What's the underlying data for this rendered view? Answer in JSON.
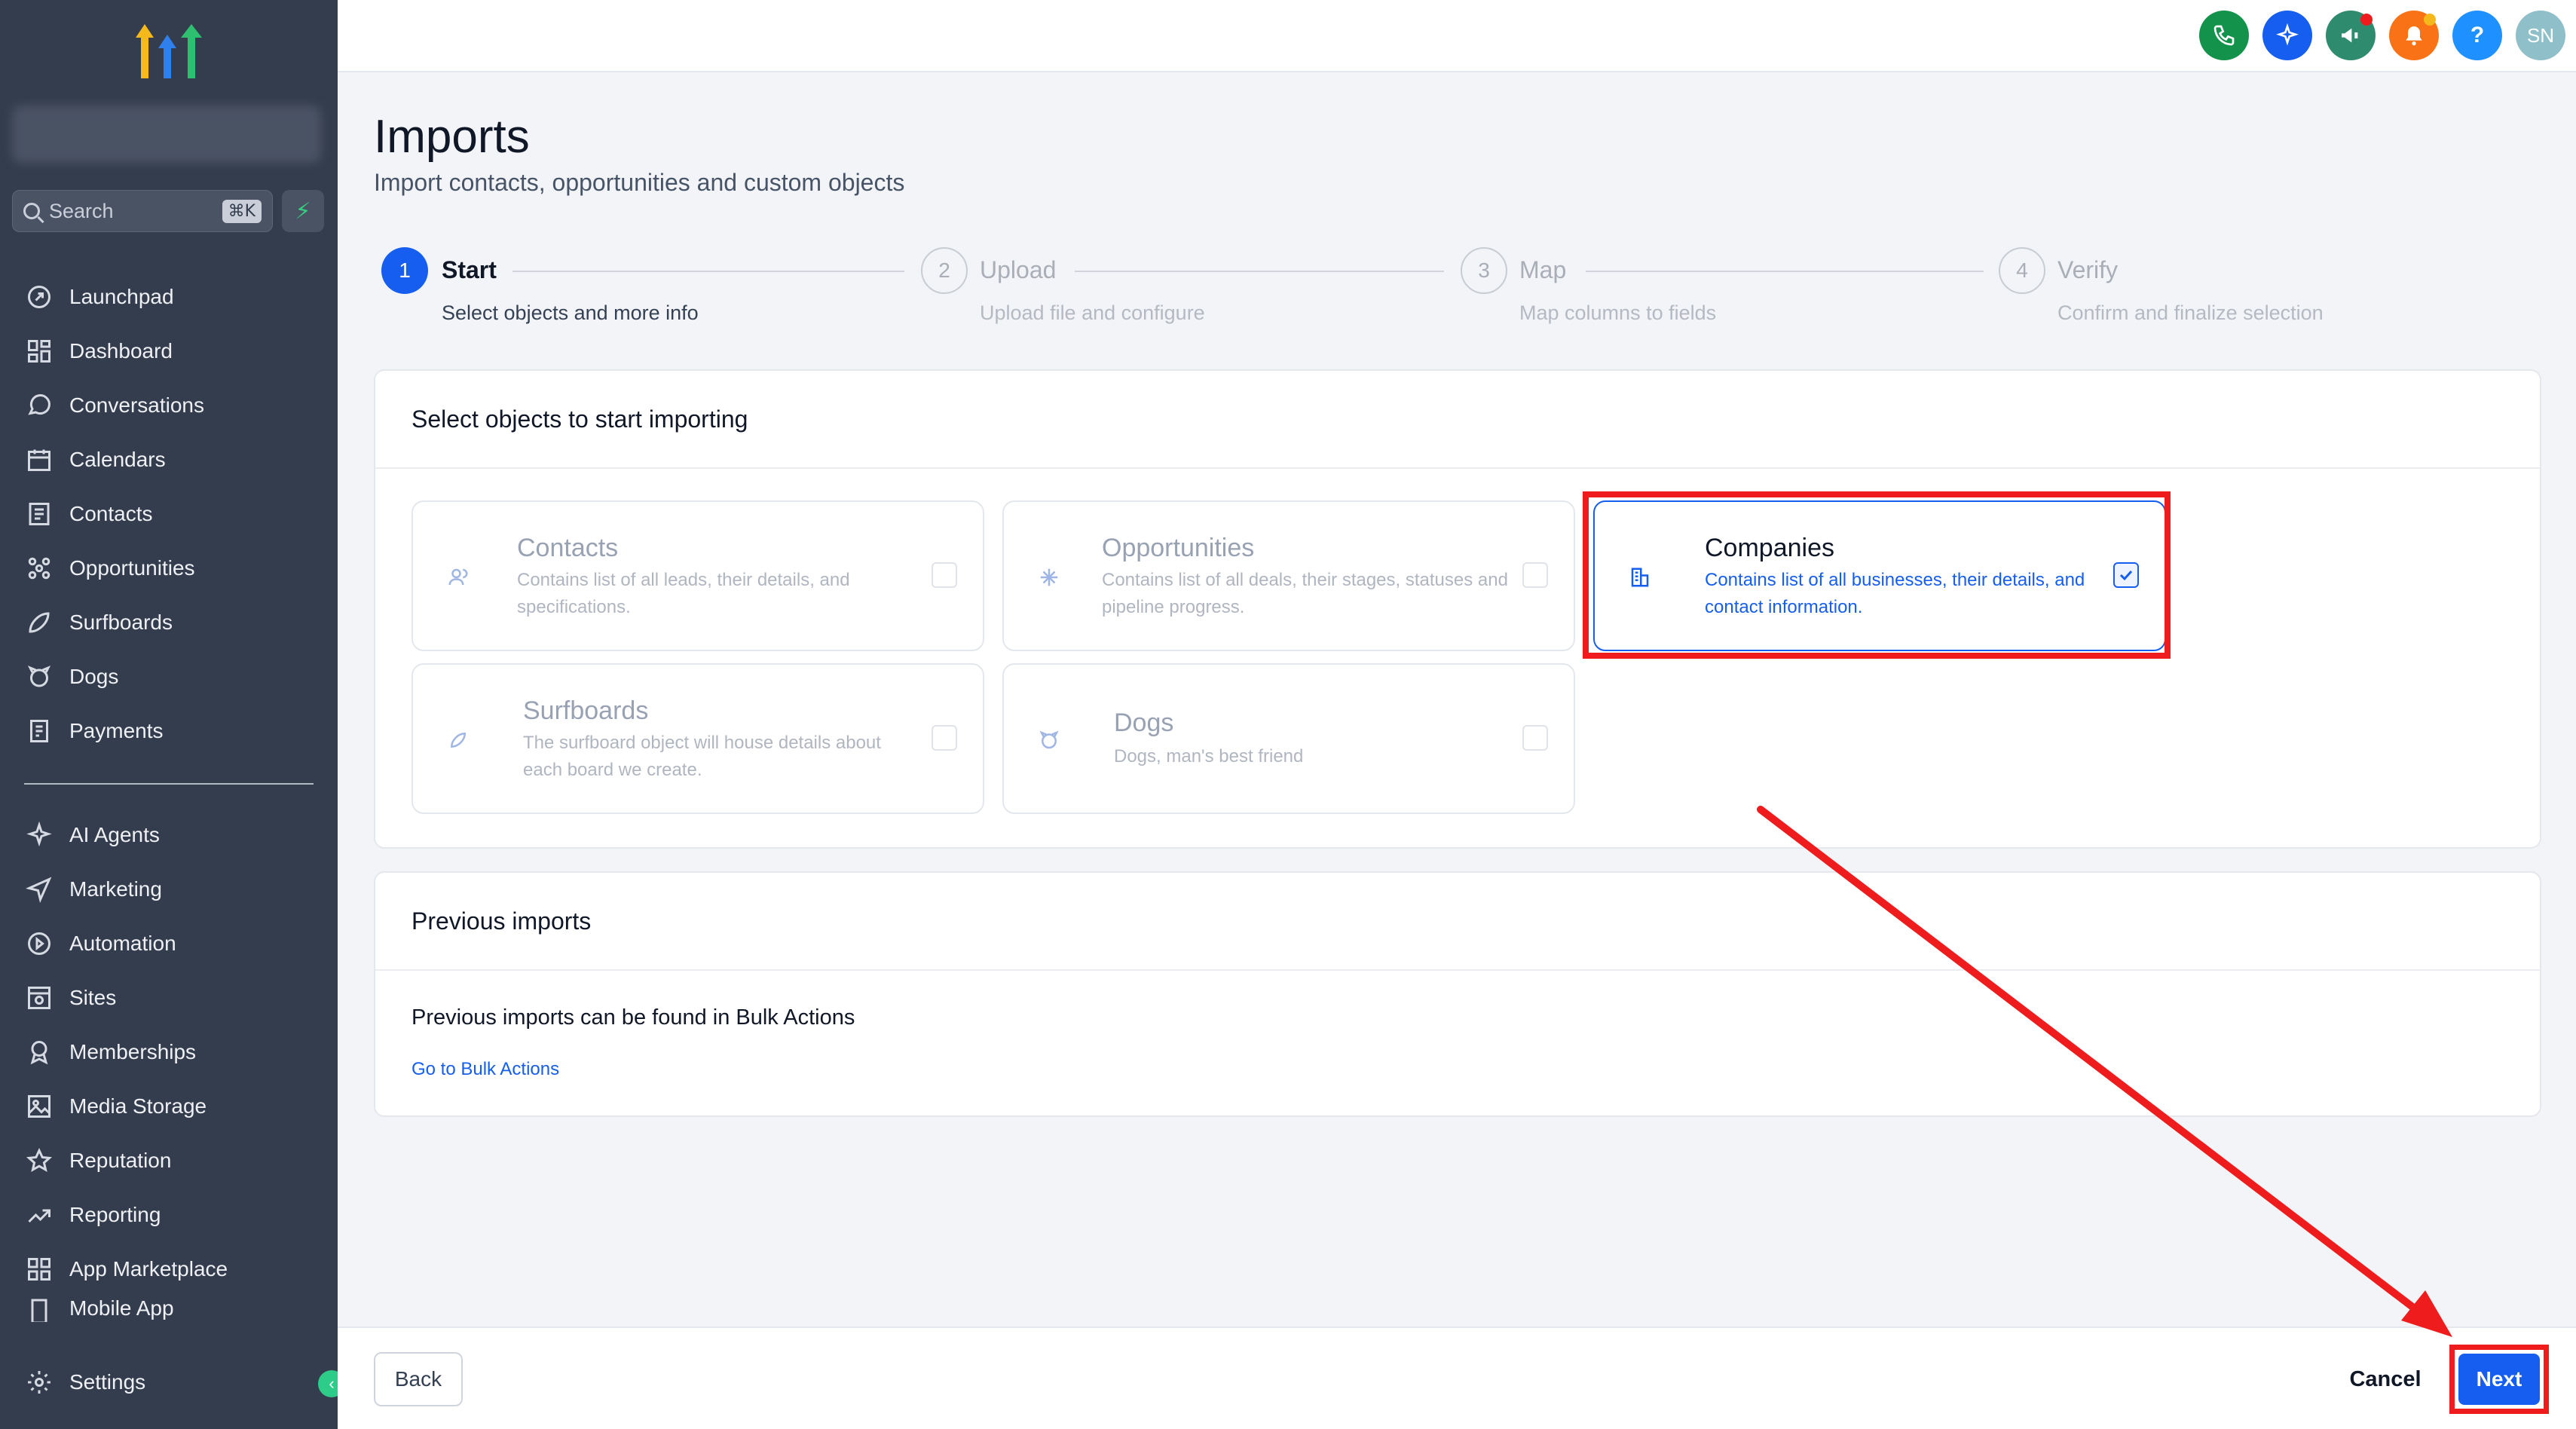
{
  "sidebar": {
    "search_placeholder": "Search",
    "search_shortcut": "⌘K",
    "items_top": [
      {
        "label": "Launchpad",
        "icon": "launchpad-icon"
      },
      {
        "label": "Dashboard",
        "icon": "dashboard-icon"
      },
      {
        "label": "Conversations",
        "icon": "chat-icon"
      },
      {
        "label": "Calendars",
        "icon": "calendar-icon"
      },
      {
        "label": "Contacts",
        "icon": "contacts-icon"
      },
      {
        "label": "Opportunities",
        "icon": "opportunities-icon"
      },
      {
        "label": "Surfboards",
        "icon": "surfboard-icon"
      },
      {
        "label": "Dogs",
        "icon": "dog-icon"
      },
      {
        "label": "Payments",
        "icon": "payments-icon"
      }
    ],
    "items_bottom": [
      {
        "label": "AI Agents",
        "icon": "sparkle-icon"
      },
      {
        "label": "Marketing",
        "icon": "send-icon"
      },
      {
        "label": "Automation",
        "icon": "automation-icon"
      },
      {
        "label": "Sites",
        "icon": "sites-icon"
      },
      {
        "label": "Memberships",
        "icon": "award-icon"
      },
      {
        "label": "Media Storage",
        "icon": "image-icon"
      },
      {
        "label": "Reputation",
        "icon": "star-icon"
      },
      {
        "label": "Reporting",
        "icon": "trend-icon"
      },
      {
        "label": "App Marketplace",
        "icon": "grid-icon"
      },
      {
        "label": "Mobile App",
        "icon": "mobile-icon"
      }
    ],
    "settings_label": "Settings"
  },
  "topbar": {
    "avatar_initials": "SN",
    "icons": [
      "phone-icon",
      "magic-icon",
      "megaphone-icon",
      "bell-icon",
      "help-icon"
    ],
    "colors": {
      "phone": "#12924a",
      "magic": "#155eef",
      "megaphone": "#2e8b6e",
      "bell": "#f97316",
      "help": "#1e90ff",
      "avatar": "#8fbfc9"
    }
  },
  "page": {
    "title": "Imports",
    "subtitle": "Import contacts, opportunities and custom objects"
  },
  "steps": [
    {
      "num": "1",
      "title": "Start",
      "desc": "Select objects and more info",
      "state": "active"
    },
    {
      "num": "2",
      "title": "Upload",
      "desc": "Upload file and configure",
      "state": "idle"
    },
    {
      "num": "3",
      "title": "Map",
      "desc": "Map columns to fields",
      "state": "idle"
    },
    {
      "num": "4",
      "title": "Verify",
      "desc": "Confirm and finalize selection",
      "state": "idle"
    }
  ],
  "select_card": {
    "heading": "Select objects to start importing",
    "objects": [
      {
        "title": "Contacts",
        "desc": "Contains list of all leads, their details, and specifications.",
        "icon": "contacts-icon",
        "checked": false
      },
      {
        "title": "Opportunities",
        "desc": "Contains list of all deals, their stages, statuses and pipeline progress.",
        "icon": "opportunities-icon",
        "checked": false
      },
      {
        "title": "Companies",
        "desc": "Contains list of all businesses, their details, and contact information.",
        "icon": "building-icon",
        "checked": true
      },
      {
        "title": "Surfboards",
        "desc": "The surfboard object will house details about each board we create.",
        "icon": "surfboard-icon",
        "checked": false
      },
      {
        "title": "Dogs",
        "desc": "Dogs, man's best friend",
        "icon": "dog-icon",
        "checked": false
      }
    ]
  },
  "previous_card": {
    "heading": "Previous imports",
    "text": "Previous imports can be found in Bulk Actions",
    "link": "Go to Bulk Actions"
  },
  "footer": {
    "back": "Back",
    "cancel": "Cancel",
    "next": "Next"
  },
  "colors": {
    "accent": "#155eef",
    "annotation": "#ee1c1c",
    "sidebar_bg": "#343d4d"
  }
}
